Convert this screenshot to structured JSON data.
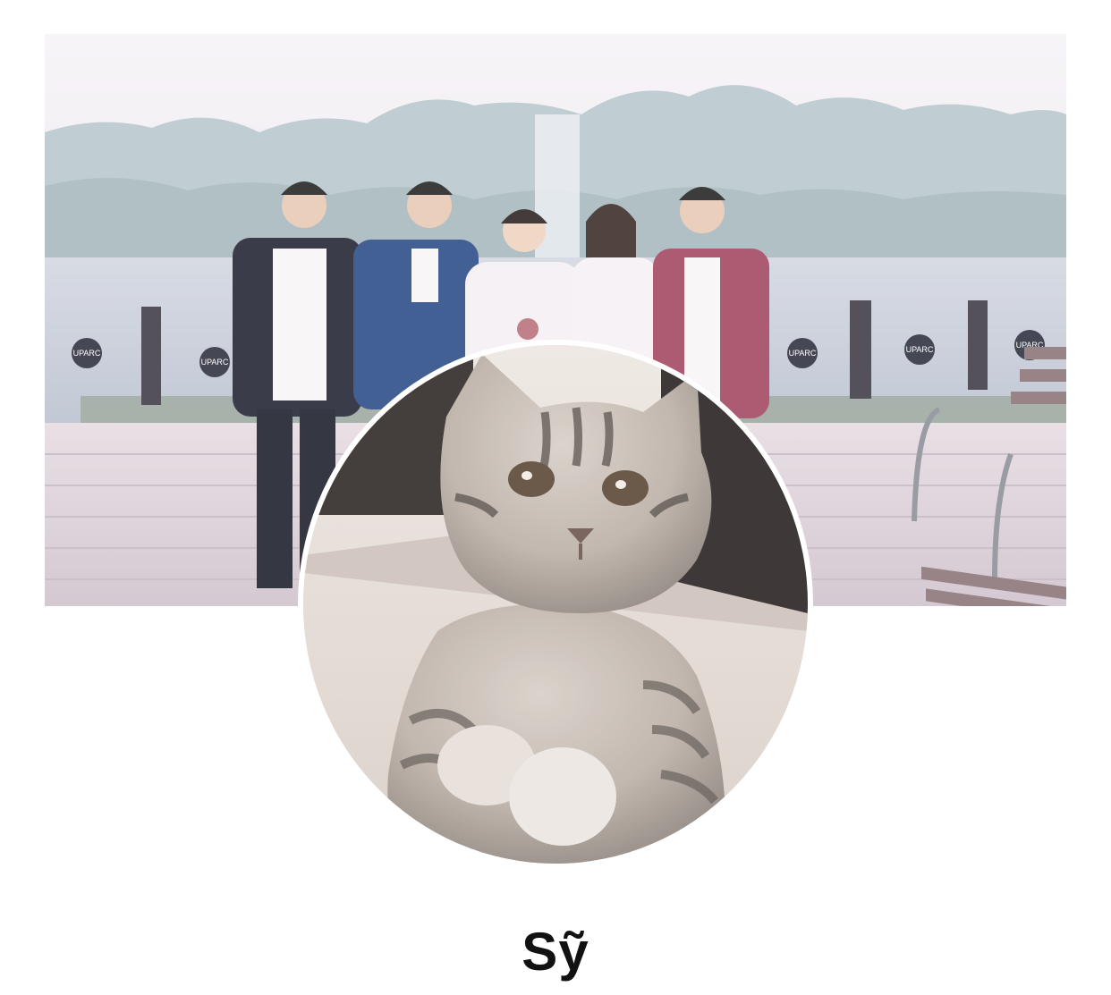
{
  "profile": {
    "name": "Sỹ",
    "cover_signs": [
      "UPARC",
      "UPARC",
      "UPARC",
      "UPARC",
      "UPARC"
    ]
  },
  "colors": {
    "background": "#ffffff",
    "name_text": "#111111",
    "cover_sky": "#f1ecf2",
    "cover_water": "#c9cfdb",
    "cover_deck": "#dcd1d9"
  }
}
